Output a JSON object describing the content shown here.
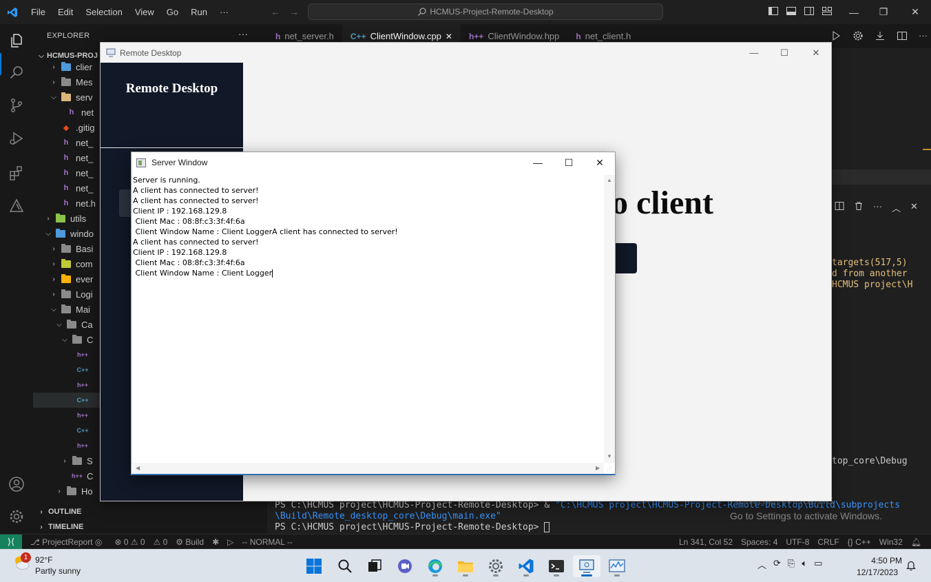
{
  "titlebar": {
    "menu": [
      "File",
      "Edit",
      "Selection",
      "View",
      "Go",
      "Run",
      "···"
    ],
    "search_text": "HCMUS-Project-Remote-Desktop"
  },
  "sidebar": {
    "title": "EXPLORER",
    "more": "···",
    "root": "HCMUS-PROJ",
    "items": [
      {
        "label": "clier",
        "type": "folder",
        "color": "#4d9bdc"
      },
      {
        "label": "Mes",
        "type": "folder",
        "color": "#8a8a8a"
      },
      {
        "label": "serv",
        "type": "folder-open",
        "color": "#dcb67a"
      },
      {
        "label": "net",
        "type": "h"
      },
      {
        "label": ".gitig",
        "type": "git"
      },
      {
        "label": "net_",
        "type": "h"
      },
      {
        "label": "net_",
        "type": "h"
      },
      {
        "label": "net_",
        "type": "h"
      },
      {
        "label": "net_",
        "type": "h"
      },
      {
        "label": "net.h",
        "type": "h"
      },
      {
        "label": "utils",
        "type": "folder",
        "color": "#8bc34a"
      },
      {
        "label": "windo",
        "type": "folder-open",
        "color": "#4d9bdc"
      },
      {
        "label": "Basi",
        "type": "folder",
        "color": "#8a8a8a"
      },
      {
        "label": "com",
        "type": "folder",
        "color": "#c0ca33"
      },
      {
        "label": "ever",
        "type": "folder",
        "color": "#ffb300"
      },
      {
        "label": "Logi",
        "type": "folder",
        "color": "#8a8a8a"
      },
      {
        "label": "Mai",
        "type": "folder-open",
        "color": "#8a8a8a"
      },
      {
        "label": "Ca",
        "type": "folder-open",
        "color": "#8a8a8a"
      },
      {
        "label": "C",
        "type": "folder-open",
        "color": "#8a8a8a"
      },
      {
        "label": "",
        "type": "hpp"
      },
      {
        "label": "",
        "type": "cpp"
      },
      {
        "label": "",
        "type": "hpp"
      },
      {
        "label": "",
        "type": "cpp"
      },
      {
        "label": "",
        "type": "hpp"
      },
      {
        "label": "",
        "type": "cpp"
      },
      {
        "label": "",
        "type": "hpp"
      },
      {
        "label": "S",
        "type": "folder",
        "color": "#8a8a8a"
      },
      {
        "label": "C",
        "type": "hpp"
      },
      {
        "label": "Ho",
        "type": "folder",
        "color": "#8a8a8a"
      }
    ],
    "outline": "OUTLINE",
    "timeline": "TIMELINE"
  },
  "tabs": [
    {
      "label": "net_server.h",
      "icon": "h",
      "active": false
    },
    {
      "label": "ClientWindow.cpp",
      "icon": "C++",
      "active": true,
      "close": "✕"
    },
    {
      "label": "ClientWindow.hpp",
      "icon": "h++",
      "active": false
    },
    {
      "label": "net_client.h",
      "icon": "h",
      "active": false
    }
  ],
  "terminal": {
    "partial_lines": [
      "targets(517,5)",
      "d from another",
      "HCMUS project\\H"
    ],
    "partial_debug": "top_core\\Debug",
    "prompt1": "PS C:\\HCMUS project\\HCMUS-Project-Remote-Desktop> & ",
    "cmd1": "\"C:\\HCMUS project\\HCMUS-Project-Remote-Desktop\\Build\\subprojects",
    "cmd2": "\\Build\\Remote_desktop_core\\Debug\\main.exe\"",
    "prompt2": "PS C:\\HCMUS project\\HCMUS-Project-Remote-Desktop> "
  },
  "watermark": {
    "title": "Activate Windows",
    "subtitle": "Go to Settings to activate Windows."
  },
  "statusbar": {
    "branch": "ProjectReport",
    "problems": "⊗ 0 ⚠ 0",
    "ports": "⚠ 0",
    "build": "Build",
    "mode": "-- NORMAL --",
    "position": "Ln 341, Col 52",
    "spaces": "Spaces: 4",
    "encoding": "UTF-8",
    "eol": "CRLF",
    "language": "{} C++",
    "platform": "Win32"
  },
  "remote_desktop": {
    "window_title": "Remote Desktop",
    "sidebar_title": "Remote Desktop",
    "heading_visible": "o client"
  },
  "server_window": {
    "title": "Server Window",
    "lines": [
      "Server is running.",
      "A client has connected to server!",
      "A client has connected to server!",
      "Client IP : 192.168.129.8",
      " Client Mac : 08:8f:c3:3f:4f:6a",
      " Client Window Name : Client LoggerA client has connected to server!",
      "A client has connected to server!",
      "Client IP : 192.168.129.8",
      " Client Mac : 08:8f:c3:3f:4f:6a",
      " Client Window Name : Client Logger"
    ]
  },
  "taskbar": {
    "weather_temp": "92°F",
    "weather_desc": "Partly sunny",
    "weather_badge": "1",
    "time": "4:50 PM",
    "date": "12/17/2023"
  }
}
